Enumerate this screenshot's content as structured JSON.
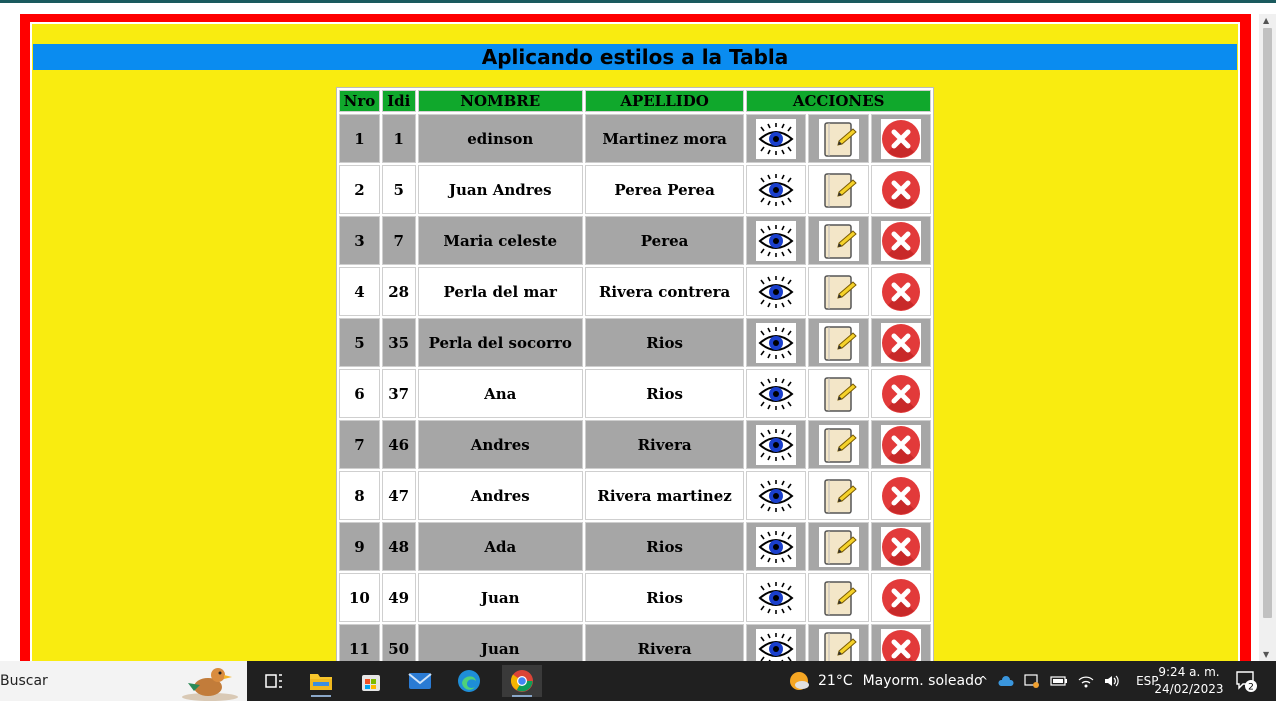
{
  "page": {
    "title": "Aplicando estilos a la Tabla"
  },
  "table": {
    "headers": [
      "Nro",
      "Idi",
      "NOMBRE",
      "APELLIDO",
      "ACCIONES"
    ],
    "rows": [
      {
        "nro": "1",
        "idi": "1",
        "nombre": "edinson",
        "apellido": "Martinez mora"
      },
      {
        "nro": "2",
        "idi": "5",
        "nombre": "Juan Andres",
        "apellido": "Perea Perea"
      },
      {
        "nro": "3",
        "idi": "7",
        "nombre": "Maria celeste",
        "apellido": "Perea"
      },
      {
        "nro": "4",
        "idi": "28",
        "nombre": "Perla del mar",
        "apellido": "Rivera contrera"
      },
      {
        "nro": "5",
        "idi": "35",
        "nombre": "Perla del socorro",
        "apellido": "Rios"
      },
      {
        "nro": "6",
        "idi": "37",
        "nombre": "Ana",
        "apellido": "Rios"
      },
      {
        "nro": "7",
        "idi": "46",
        "nombre": "Andres",
        "apellido": "Rivera"
      },
      {
        "nro": "8",
        "idi": "47",
        "nombre": "Andres",
        "apellido": "Rivera martinez"
      },
      {
        "nro": "9",
        "idi": "48",
        "nombre": "Ada",
        "apellido": "Rios"
      },
      {
        "nro": "10",
        "idi": "49",
        "nombre": "Juan",
        "apellido": "Rios"
      },
      {
        "nro": "11",
        "idi": "50",
        "nombre": "Juan",
        "apellido": "Rivera"
      }
    ],
    "action_icons": [
      "eye-icon",
      "edit-notepad-icon",
      "delete-icon"
    ]
  },
  "colors": {
    "frame": "#ff0000",
    "panel": "#f9ec10",
    "title_bar": "#0a8cf0",
    "header": "#10a82c",
    "row_alt": "#a6a6a6"
  },
  "taskbar": {
    "search_label": "Buscar",
    "weather_temp": "21°C",
    "weather_desc": "Mayorm. soleado",
    "language": "ESP",
    "time": "9:24 a. m.",
    "date": "24/02/2023",
    "notification_count": "2"
  }
}
